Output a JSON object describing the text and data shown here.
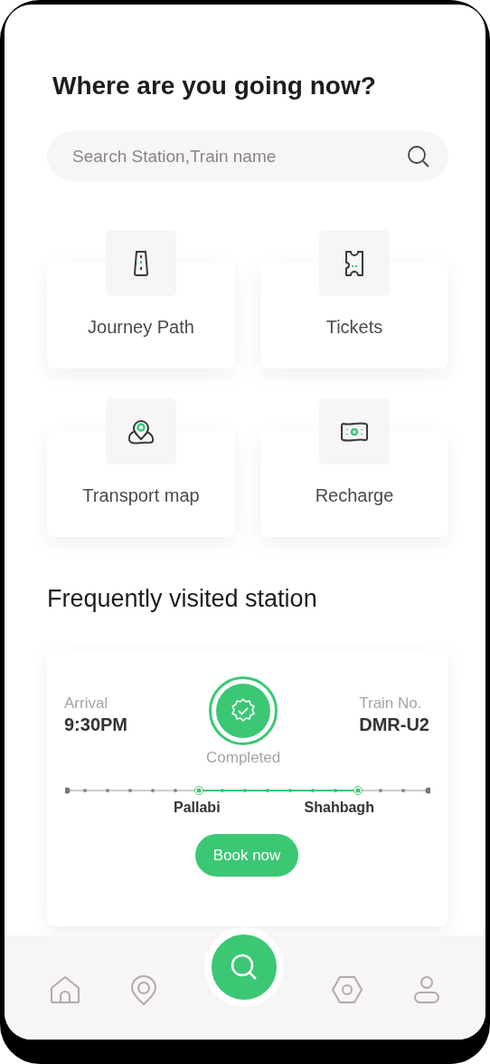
{
  "heading": "Where are you going now?",
  "search": {
    "placeholder": "Search Station,Train name"
  },
  "tiles": [
    {
      "kind": "road",
      "label": "Journey Path"
    },
    {
      "kind": "ticket",
      "label": "Tickets"
    },
    {
      "kind": "map",
      "label": "Transport map"
    },
    {
      "kind": "money",
      "label": "Recharge"
    }
  ],
  "section_title": "Frequently visited station",
  "trip": {
    "arrival_label": "Arrival",
    "arrival_time": "9:30PM",
    "status": "Completed",
    "train_label": "Train No.",
    "train_number": "DMR-U2",
    "from": "Pallabi",
    "to": "Shahbagh",
    "action": "Book now"
  },
  "nav": [
    {
      "kind": "home"
    },
    {
      "kind": "pin"
    },
    {
      "kind": "search"
    },
    {
      "kind": "hexagon"
    },
    {
      "kind": "user"
    }
  ]
}
